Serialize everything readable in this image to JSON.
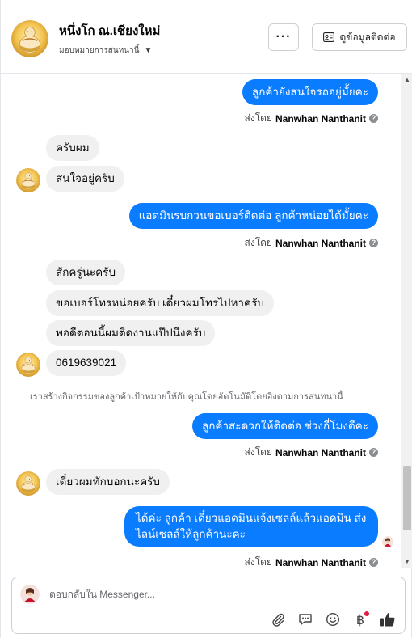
{
  "header": {
    "page_name": "หนึ่งโก ณ.เชียงใหม่",
    "assign_label": "มอบหมายการสนทนานี้",
    "more_label": "···",
    "contact_button_label": "ดูข้อมูลติดต่อ"
  },
  "sent_by": {
    "prefix": "ส่งโดย",
    "name": "Nanwhan Nanthanit",
    "help_icon": "?"
  },
  "messages": [
    {
      "from": "agent",
      "text": "ลูกค้ายังสนใจรถอยู่มั้ยคะ"
    },
    {
      "from": "customer",
      "text": "ครับผม"
    },
    {
      "from": "customer",
      "text": "สนใจอยู่ครับ"
    },
    {
      "from": "agent",
      "text": "แอดมินรบกวนขอเบอร์ติดต่อ ลูกค้าหน่อยได้มั้ยคะ"
    },
    {
      "from": "customer",
      "text": "สักครู่นะครับ"
    },
    {
      "from": "customer",
      "text": "ขอเบอร์โทรหน่อยครับ เดี๋ยวผมโทรไปหาครับ"
    },
    {
      "from": "customer",
      "text": "พอดีตอนนี้ผมติดงานแป๊ปนึงครับ"
    },
    {
      "from": "customer",
      "text": "0619639021"
    },
    {
      "from": "agent",
      "text": "ลูกค้าสะดวกให้ติดต่อ ช่วงกี่โมงดีคะ"
    },
    {
      "from": "customer",
      "text": "เดี๋ยวผมทักบอกนะครับ"
    },
    {
      "from": "agent",
      "text": "ได้ค่ะ ลูกค้า เดี๋ยวแอดมินแจ้งเซลล์แล้วแอดมิน ส่งไลน์เซลล์ให้ลูกค้านะคะ"
    }
  ],
  "system_note": "เราสร้างกิจกรรมของลูกค้าเป้าหมายให้กับคุณโดยอัตโนมัติโดยอิงตามการสนทนานี้",
  "composer": {
    "placeholder": "ตอบกลับใน Messenger...",
    "tools": [
      "attachment-icon",
      "saved-reply-icon",
      "emoji-icon",
      "payment-icon",
      "like-icon"
    ],
    "payment_glyph": "฿"
  },
  "colors": {
    "outgoing_bubble": "#0a7cff",
    "incoming_bubble": "#f0f0f0",
    "accent": "#0866ff"
  }
}
